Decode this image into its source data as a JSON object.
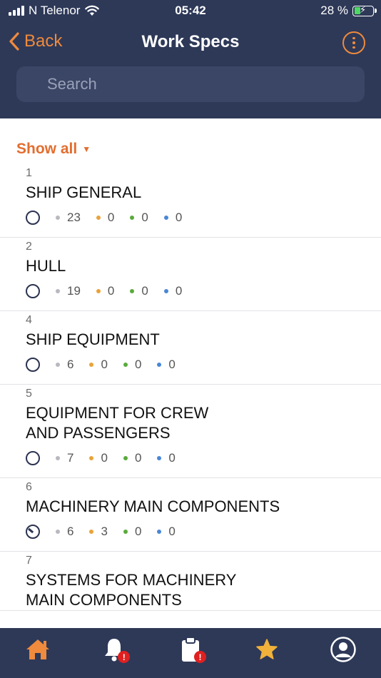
{
  "status_bar": {
    "carrier": "N Telenor",
    "time": "05:42",
    "battery": "28 %"
  },
  "nav": {
    "back_label": "Back",
    "title": "Work Specs"
  },
  "search": {
    "placeholder": "Search"
  },
  "filter": {
    "label": "Show all"
  },
  "colors": {
    "accent": "#f08a3c",
    "navy": "#2e3958",
    "gray_dot": "#b8b8bf",
    "orange_dot": "#e9a33a",
    "green_dot": "#5aaa3c",
    "blue_dot": "#4a86d6"
  },
  "specs": [
    {
      "number": "1",
      "title": "SHIP GENERAL",
      "status": "empty",
      "gray": "23",
      "orange": "0",
      "green": "0",
      "blue": "0"
    },
    {
      "number": "2",
      "title": "HULL",
      "status": "empty",
      "gray": "19",
      "orange": "0",
      "green": "0",
      "blue": "0"
    },
    {
      "number": "4",
      "title": "SHIP EQUIPMENT",
      "status": "empty",
      "gray": "6",
      "orange": "0",
      "green": "0",
      "blue": "0"
    },
    {
      "number": "5",
      "title": "EQUIPMENT FOR CREW\nAND PASSENGERS",
      "status": "empty",
      "gray": "7",
      "orange": "0",
      "green": "0",
      "blue": "0"
    },
    {
      "number": "6",
      "title": "MACHINERY MAIN COMPONENTS",
      "status": "partial",
      "gray": "6",
      "orange": "3",
      "green": "0",
      "blue": "0"
    },
    {
      "number": "7",
      "title": "SYSTEMS FOR MACHINERY\nMAIN COMPONENTS",
      "status": "empty",
      "gray": "",
      "orange": "",
      "green": "",
      "blue": ""
    }
  ],
  "tab_bar": {
    "tabs": [
      {
        "icon": "home-icon",
        "badge": ""
      },
      {
        "icon": "bell-icon",
        "badge": "!"
      },
      {
        "icon": "clipboard-icon",
        "badge": "!"
      },
      {
        "icon": "star-icon",
        "badge": ""
      },
      {
        "icon": "profile-icon",
        "badge": ""
      }
    ]
  }
}
